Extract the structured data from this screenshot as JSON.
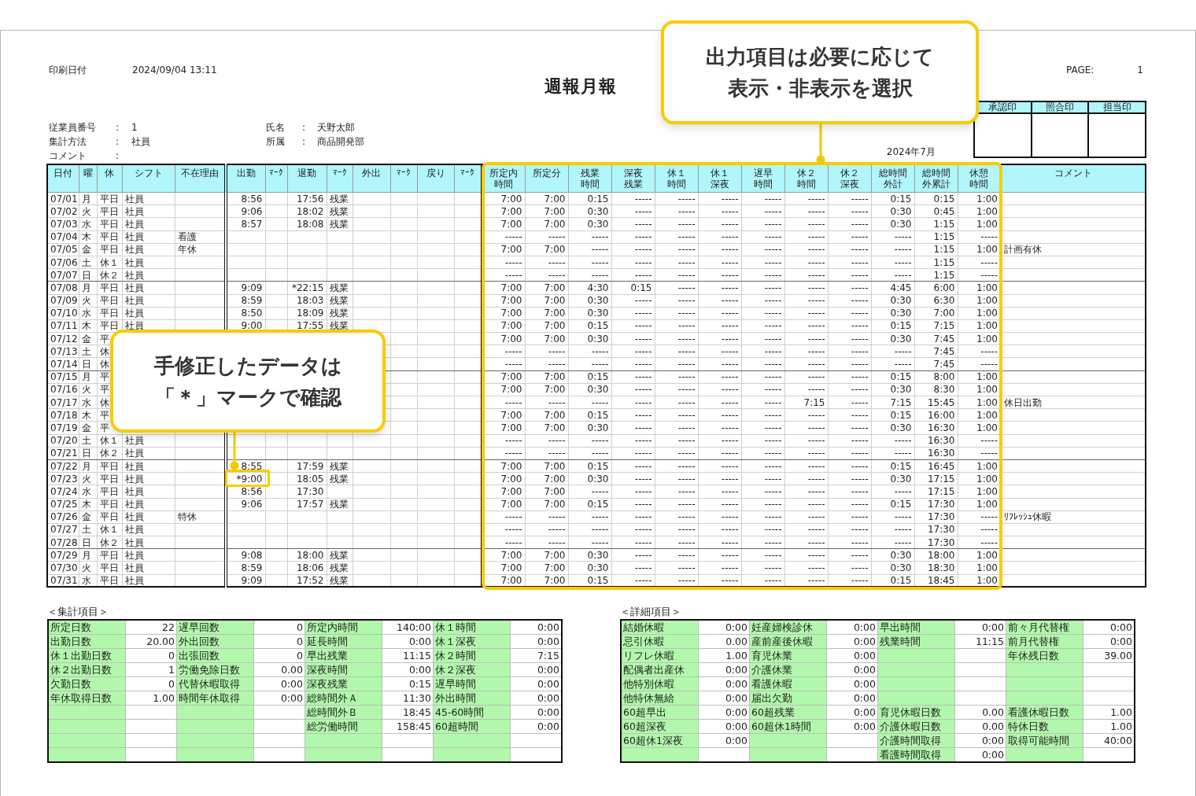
{
  "report": {
    "print_date_label": "印刷日付",
    "print_date": "2024/09/04 13:11",
    "title": "週報月報",
    "page_label": "PAGE:",
    "page": "1",
    "period": "2024年7月"
  },
  "employee_info": {
    "left": [
      {
        "label": "従業員番号",
        "separator": ":",
        "value": "1"
      },
      {
        "label": "集計方法",
        "separator": ":",
        "value": "社員"
      },
      {
        "label": "コメント",
        "separator": ":"
      }
    ],
    "right": [
      {
        "label": "氏名",
        "separator": ":",
        "value": "天野太郎"
      },
      {
        "label": "所属",
        "separator": ":",
        "value": "商品開発部"
      }
    ]
  },
  "approval_stamps": [
    {
      "label": "承認印"
    },
    {
      "label": "照合印"
    },
    {
      "label": "担当印"
    }
  ],
  "attendance_table": {
    "columns": [
      {
        "label": "日付",
        "kind": "text"
      },
      {
        "label": "曜",
        "kind": "text"
      },
      {
        "label": "休",
        "kind": "text"
      },
      {
        "label": "シフト",
        "kind": "text"
      },
      {
        "label": "不在理由",
        "kind": "text"
      },
      {
        "label": "出勤",
        "kind": "time"
      },
      {
        "label": "ﾏｰｸ",
        "kind": "mark"
      },
      {
        "label": "退勤",
        "kind": "time"
      },
      {
        "label": "ﾏｰｸ",
        "kind": "mark"
      },
      {
        "label": "外出",
        "kind": "time"
      },
      {
        "label": "ﾏｰｸ",
        "kind": "mark"
      },
      {
        "label": "戻り",
        "kind": "time"
      },
      {
        "label": "ﾏｰｸ",
        "kind": "mark"
      },
      {
        "label": "所定内時間",
        "kind": "time"
      },
      {
        "label": "所定分",
        "kind": "time"
      },
      {
        "label": "残業時間",
        "kind": "time"
      },
      {
        "label": "深夜残業",
        "kind": "time"
      },
      {
        "label": "休１時間",
        "kind": "time"
      },
      {
        "label": "休１深夜",
        "kind": "time"
      },
      {
        "label": "遅早時間",
        "kind": "time"
      },
      {
        "label": "休２時間",
        "kind": "time"
      },
      {
        "label": "休２深夜",
        "kind": "time"
      },
      {
        "label": "総時間外計",
        "kind": "time"
      },
      {
        "label": "総時間外累計",
        "kind": "time"
      },
      {
        "label": "休憩時間",
        "kind": "time"
      },
      {
        "label": "コメント",
        "kind": "text"
      }
    ],
    "rows": [
      [
        "07/01",
        "月",
        "平日",
        "社員",
        null,
        "8:56",
        null,
        "17:56",
        "残業",
        null,
        null,
        null,
        null,
        "7:00",
        "7:00",
        "0:15",
        "-----",
        "-----",
        "-----",
        "-----",
        "-----",
        "-----",
        "0:15",
        "0:15",
        "1:00",
        null
      ],
      [
        "07/02",
        "火",
        "平日",
        "社員",
        null,
        "9:06",
        null,
        "18:02",
        "残業",
        null,
        null,
        null,
        null,
        "7:00",
        "7:00",
        "0:30",
        "-----",
        "-----",
        "-----",
        "-----",
        "-----",
        "-----",
        "0:30",
        "0:45",
        "1:00",
        null
      ],
      [
        "07/03",
        "水",
        "平日",
        "社員",
        null,
        "8:57",
        null,
        "18:08",
        "残業",
        null,
        null,
        null,
        null,
        "7:00",
        "7:00",
        "0:30",
        "-----",
        "-----",
        "-----",
        "-----",
        "-----",
        "-----",
        "0:30",
        "1:15",
        "1:00",
        null
      ],
      [
        "07/04",
        "木",
        "平日",
        "社員",
        "看護",
        null,
        null,
        null,
        null,
        null,
        null,
        null,
        null,
        "-----",
        "-----",
        "-----",
        "-----",
        "-----",
        "-----",
        "-----",
        "-----",
        "-----",
        "-----",
        "1:15",
        "-----",
        null
      ],
      [
        "07/05",
        "金",
        "平日",
        "社員",
        "年休",
        null,
        null,
        null,
        null,
        null,
        null,
        null,
        null,
        "7:00",
        "7:00",
        "-----",
        "-----",
        "-----",
        "-----",
        "-----",
        "-----",
        "-----",
        "-----",
        "1:15",
        "1:00",
        "計画有休"
      ],
      [
        "07/06",
        "土",
        "休１",
        "社員",
        null,
        null,
        null,
        null,
        null,
        null,
        null,
        null,
        null,
        "-----",
        "-----",
        "-----",
        "-----",
        "-----",
        "-----",
        "-----",
        "-----",
        "-----",
        "-----",
        "1:15",
        "-----",
        null
      ],
      [
        "07/07",
        "日",
        "休２",
        "社員",
        null,
        null,
        null,
        null,
        null,
        null,
        null,
        null,
        null,
        "-----",
        "-----",
        "-----",
        "-----",
        "-----",
        "-----",
        "-----",
        "-----",
        "-----",
        "-----",
        "1:15",
        "-----",
        null
      ],
      [
        "07/08",
        "月",
        "平日",
        "社員",
        null,
        "9:09",
        null,
        "*22:15",
        "残業",
        null,
        null,
        null,
        null,
        "7:00",
        "7:00",
        "4:30",
        "0:15",
        "-----",
        "-----",
        "-----",
        "-----",
        "-----",
        "4:45",
        "6:00",
        "1:00",
        null
      ],
      [
        "07/09",
        "火",
        "平日",
        "社員",
        null,
        "8:59",
        null,
        "18:03",
        "残業",
        null,
        null,
        null,
        null,
        "7:00",
        "7:00",
        "0:30",
        "-----",
        "-----",
        "-----",
        "-----",
        "-----",
        "-----",
        "0:30",
        "6:30",
        "1:00",
        null
      ],
      [
        "07/10",
        "水",
        "平日",
        "社員",
        null,
        "8:50",
        null,
        "18:09",
        "残業",
        null,
        null,
        null,
        null,
        "7:00",
        "7:00",
        "0:30",
        "-----",
        "-----",
        "-----",
        "-----",
        "-----",
        "-----",
        "0:30",
        "7:00",
        "1:00",
        null
      ],
      [
        "07/11",
        "木",
        "平日",
        "社員",
        null,
        "9:00",
        null,
        "17:55",
        "残業",
        null,
        null,
        null,
        null,
        "7:00",
        "7:00",
        "0:15",
        "-----",
        "-----",
        "-----",
        "-----",
        "-----",
        "-----",
        "0:15",
        "7:15",
        "1:00",
        null
      ],
      [
        "07/12",
        "金",
        "平",
        null,
        null,
        null,
        null,
        null,
        null,
        null,
        null,
        null,
        null,
        "7:00",
        "7:00",
        "0:30",
        "-----",
        "-----",
        "-----",
        "-----",
        "-----",
        "-----",
        "0:30",
        "7:45",
        "1:00",
        null
      ],
      [
        "07/13",
        "土",
        "休",
        null,
        null,
        null,
        null,
        null,
        null,
        null,
        null,
        null,
        null,
        "-----",
        "-----",
        "-----",
        "-----",
        "-----",
        "-----",
        "-----",
        "-----",
        "-----",
        "-----",
        "7:45",
        "-----",
        null
      ],
      [
        "07/14",
        "日",
        "休",
        null,
        null,
        null,
        null,
        null,
        null,
        null,
        null,
        null,
        null,
        "-----",
        "-----",
        "-----",
        "-----",
        "-----",
        "-----",
        "-----",
        "-----",
        "-----",
        "-----",
        "7:45",
        "-----",
        null
      ],
      [
        "07/15",
        "月",
        "平",
        null,
        null,
        null,
        null,
        null,
        null,
        null,
        null,
        null,
        null,
        "7:00",
        "7:00",
        "0:15",
        "-----",
        "-----",
        "-----",
        "-----",
        "-----",
        "-----",
        "0:15",
        "8:00",
        "1:00",
        null
      ],
      [
        "07/16",
        "火",
        "平",
        null,
        null,
        null,
        null,
        null,
        null,
        null,
        null,
        null,
        null,
        "7:00",
        "7:00",
        "0:30",
        "-----",
        "-----",
        "-----",
        "-----",
        "-----",
        "-----",
        "0:30",
        "8:30",
        "1:00",
        null
      ],
      [
        "07/17",
        "水",
        "休",
        null,
        null,
        null,
        null,
        null,
        null,
        null,
        null,
        null,
        null,
        "-----",
        "-----",
        "-----",
        "-----",
        "-----",
        "-----",
        "-----",
        "7:15",
        "-----",
        "7:15",
        "15:45",
        "1:00",
        "休日出勤"
      ],
      [
        "07/18",
        "木",
        "平",
        null,
        null,
        null,
        null,
        null,
        null,
        null,
        null,
        null,
        null,
        "7:00",
        "7:00",
        "0:15",
        "-----",
        "-----",
        "-----",
        "-----",
        "-----",
        "-----",
        "0:15",
        "16:00",
        "1:00",
        null
      ],
      [
        "07/19",
        "金",
        "平",
        null,
        null,
        null,
        null,
        null,
        null,
        null,
        null,
        null,
        null,
        "7:00",
        "7:00",
        "0:30",
        "-----",
        "-----",
        "-----",
        "-----",
        "-----",
        "-----",
        "0:30",
        "16:30",
        "1:00",
        null
      ],
      [
        "07/20",
        "土",
        "休１",
        "社員",
        null,
        null,
        null,
        null,
        null,
        null,
        null,
        null,
        null,
        "-----",
        "-----",
        "-----",
        "-----",
        "-----",
        "-----",
        "-----",
        "-----",
        "-----",
        "-----",
        "16:30",
        "-----",
        null
      ],
      [
        "07/21",
        "日",
        "休２",
        "社員",
        null,
        null,
        null,
        null,
        null,
        null,
        null,
        null,
        null,
        "-----",
        "-----",
        "-----",
        "-----",
        "-----",
        "-----",
        "-----",
        "-----",
        "-----",
        "-----",
        "16:30",
        "-----",
        null
      ],
      [
        "07/22",
        "月",
        "平日",
        "社員",
        null,
        "8:55",
        null,
        "17:59",
        "残業",
        null,
        null,
        null,
        null,
        "7:00",
        "7:00",
        "0:15",
        "-----",
        "-----",
        "-----",
        "-----",
        "-----",
        "-----",
        "0:15",
        "16:45",
        "1:00",
        null
      ],
      [
        "07/23",
        "火",
        "平日",
        "社員",
        null,
        "*9:00",
        null,
        "18:05",
        "残業",
        null,
        null,
        null,
        null,
        "7:00",
        "7:00",
        "0:30",
        "-----",
        "-----",
        "-----",
        "-----",
        "-----",
        "-----",
        "0:30",
        "17:15",
        "1:00",
        null
      ],
      [
        "07/24",
        "水",
        "平日",
        "社員",
        null,
        "8:56",
        null,
        "17:30",
        null,
        null,
        null,
        null,
        null,
        "7:00",
        "7:00",
        "-----",
        "-----",
        "-----",
        "-----",
        "-----",
        "-----",
        "-----",
        "-----",
        "17:15",
        "1:00",
        null
      ],
      [
        "07/25",
        "木",
        "平日",
        "社員",
        null,
        "9:06",
        null,
        "17:57",
        "残業",
        null,
        null,
        null,
        null,
        "7:00",
        "7:00",
        "0:15",
        "-----",
        "-----",
        "-----",
        "-----",
        "-----",
        "-----",
        "0:15",
        "17:30",
        "1:00",
        null
      ],
      [
        "07/26",
        "金",
        "平日",
        "社員",
        "特休",
        null,
        null,
        null,
        null,
        null,
        null,
        null,
        null,
        "-----",
        "-----",
        "-----",
        "-----",
        "-----",
        "-----",
        "-----",
        "-----",
        "-----",
        "-----",
        "17:30",
        "-----",
        "ﾘﾌﾚｯｼｭ休暇"
      ],
      [
        "07/27",
        "土",
        "休１",
        "社員",
        null,
        null,
        null,
        null,
        null,
        null,
        null,
        null,
        null,
        "-----",
        "-----",
        "-----",
        "-----",
        "-----",
        "-----",
        "-----",
        "-----",
        "-----",
        "-----",
        "17:30",
        "-----",
        null
      ],
      [
        "07/28",
        "日",
        "休２",
        "社員",
        null,
        null,
        null,
        null,
        null,
        null,
        null,
        null,
        null,
        "-----",
        "-----",
        "-----",
        "-----",
        "-----",
        "-----",
        "-----",
        "-----",
        "-----",
        "-----",
        "17:30",
        "-----",
        null
      ],
      [
        "07/29",
        "月",
        "平日",
        "社員",
        null,
        "9:08",
        null,
        "18:00",
        "残業",
        null,
        null,
        null,
        null,
        "7:00",
        "7:00",
        "0:30",
        "-----",
        "-----",
        "-----",
        "-----",
        "-----",
        "-----",
        "0:30",
        "18:00",
        "1:00",
        null
      ],
      [
        "07/30",
        "火",
        "平日",
        "社員",
        null,
        "8:59",
        null,
        "18:06",
        "残業",
        null,
        null,
        null,
        null,
        "7:00",
        "7:00",
        "0:30",
        "-----",
        "-----",
        "-----",
        "-----",
        "-----",
        "-----",
        "0:30",
        "18:30",
        "1:00",
        null
      ],
      [
        "07/31",
        "水",
        "平日",
        "社員",
        null,
        "9:09",
        null,
        "17:52",
        "残業",
        null,
        null,
        null,
        null,
        "7:00",
        "7:00",
        "0:15",
        "-----",
        "-----",
        "-----",
        "-----",
        "-----",
        "-----",
        "0:15",
        "18:45",
        "1:00",
        null
      ]
    ]
  },
  "summary": {
    "title": "＜集計項目＞",
    "groups": [
      {
        "items": [
          {
            "label": "所定日数",
            "value": "22"
          },
          {
            "label": "出勤日数",
            "value": "20.00"
          },
          {
            "label": "休１出勤日数",
            "value": "0"
          },
          {
            "label": "休２出勤日数",
            "value": "1"
          },
          {
            "label": "欠勤日数",
            "value": "0"
          },
          {
            "label": "年休取得日数",
            "value": "1.00"
          }
        ]
      },
      {
        "items": [
          {
            "label": "遅早回数",
            "value": "0"
          },
          {
            "label": "外出回数",
            "value": "0"
          },
          {
            "label": "出張回数",
            "value": "0"
          },
          {
            "label": "労働免除日数",
            "value": "0.00"
          },
          {
            "label": "代替休暇取得",
            "value": "0:00"
          },
          {
            "label": "時間年休取得",
            "value": "0:00"
          }
        ]
      },
      {
        "items": [
          {
            "label": "所定内時間",
            "value": "140:00"
          },
          {
            "label": "延長時間",
            "value": "0:00"
          },
          {
            "label": "早出残業",
            "value": "11:15"
          },
          {
            "label": "深夜時間",
            "value": "0:00"
          },
          {
            "label": "深夜残業",
            "value": "0:15"
          },
          {
            "label": "総時間外Ａ",
            "value": "11:30"
          },
          {
            "label": "総時間外Ｂ",
            "value": "18:45"
          },
          {
            "label": "総労働時間",
            "value": "158:45"
          }
        ]
      },
      {
        "items": [
          {
            "label": "休１時間",
            "value": "0:00"
          },
          {
            "label": "休１深夜",
            "value": "0:00"
          },
          {
            "label": "休２時間",
            "value": "7:15"
          },
          {
            "label": "休２深夜",
            "value": "0:00"
          },
          {
            "label": "遅早時間",
            "value": "0:00"
          },
          {
            "label": "外出時間",
            "value": "0:00"
          },
          {
            "label": "45-60時間",
            "value": "0:00"
          },
          {
            "label": "60超時間",
            "value": "0:00"
          }
        ]
      }
    ]
  },
  "details": {
    "title": "＜詳細項目＞",
    "groups": [
      {
        "items": [
          {
            "label": "結婚休暇",
            "value": "0:00"
          },
          {
            "label": "忌引休暇",
            "value": "0.00"
          },
          {
            "label": "リフレ休暇",
            "value": "1.00"
          },
          {
            "label": "配偶者出産休",
            "value": "0:00"
          },
          {
            "label": "他特別休暇",
            "value": "0:00"
          },
          {
            "label": "他特休無給",
            "value": "0:00"
          },
          {
            "label": "60超早出",
            "value": "0:00"
          },
          {
            "label": "60超深夜",
            "value": "0:00"
          },
          {
            "label": "60超休1深夜",
            "value": "0:00"
          }
        ]
      },
      {
        "items": [
          {
            "label": "妊産婦検診休",
            "value": "0:00"
          },
          {
            "label": "産前産後休暇",
            "value": "0:00"
          },
          {
            "label": "育児休業",
            "value": "0:00"
          },
          {
            "label": "介護休業",
            "value": "0:00"
          },
          {
            "label": "看護休暇",
            "value": "0:00"
          },
          {
            "label": "届出欠勤",
            "value": "0:00"
          },
          {
            "label": "60超残業",
            "value": "0:00"
          },
          {
            "label": "60超休1時間",
            "value": "0:00"
          }
        ]
      },
      {
        "items": [
          {
            "label": "早出時間",
            "value": "0:00"
          },
          {
            "label": "残業時間",
            "value": "11:15"
          }
        ],
        "lower_items": [
          {
            "label": "育児休暇日数",
            "value": "0.00"
          },
          {
            "label": "介護休暇日数",
            "value": "0.00"
          },
          {
            "label": "介護時間取得",
            "value": "0:00"
          },
          {
            "label": "看護時間取得",
            "value": "0:00"
          }
        ]
      },
      {
        "items": [
          {
            "label": "前々月代替権",
            "value": "0:00"
          },
          {
            "label": "前月代替権",
            "value": "0:00"
          },
          {
            "label": "年休残日数",
            "value": "39.00"
          }
        ],
        "lower_items": [
          {
            "label": "看護休暇日数",
            "value": "1.00"
          },
          {
            "label": "特休日数",
            "value": "1.00"
          },
          {
            "label": "取得可能時間",
            "value": "40:00"
          }
        ]
      }
    ]
  },
  "callouts": [
    {
      "lines": [
        "出力項目は必要に応じて",
        "表示・非表示を選択"
      ]
    },
    {
      "lines": [
        "手修正したデータは",
        "「＊」マークで確認"
      ]
    }
  ]
}
